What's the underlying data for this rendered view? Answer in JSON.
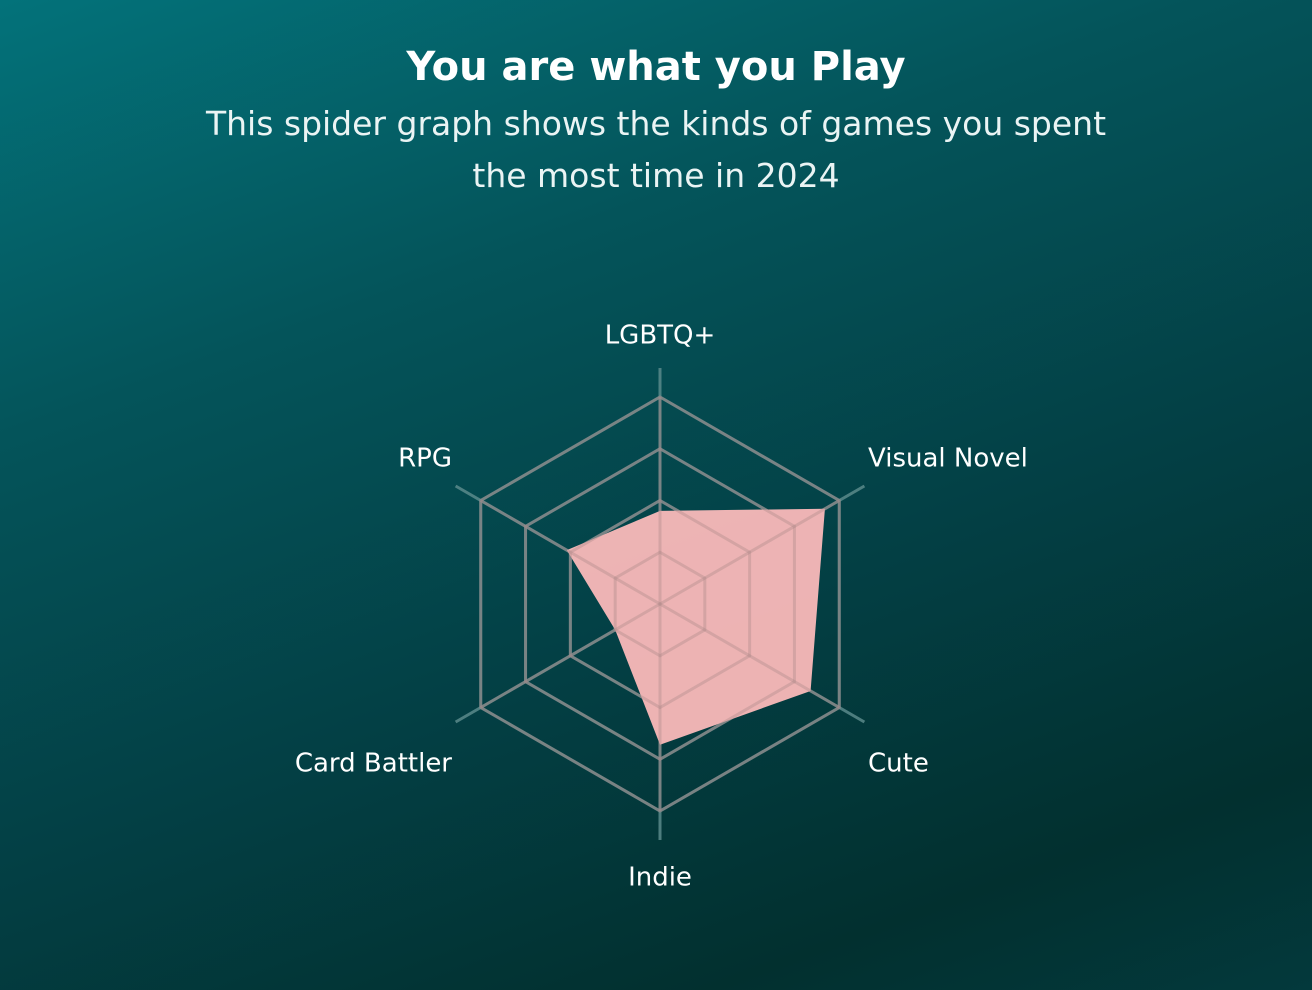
{
  "header": {
    "title": "You are what you Play",
    "subtitle": "This spider graph shows the kinds of games you spent the most time in 2024"
  },
  "chart_data": {
    "type": "radar",
    "title": "You are what you Play",
    "subtitle": "This spider graph shows the kinds of games you spent the most time in 2024",
    "categories": [
      "LGBTQ+",
      "Visual Novel",
      "Cute",
      "Indie",
      "Card Battler",
      "RPG"
    ],
    "series": [
      {
        "values": [
          0.45,
          0.92,
          0.84,
          0.68,
          0.25,
          0.52
        ]
      }
    ],
    "range": [
      0,
      1
    ],
    "rings": 4,
    "grid": true,
    "colors": {
      "fill": "#ffbcbc",
      "grid": "#5a8a8b",
      "text": "#ffffff"
    }
  }
}
